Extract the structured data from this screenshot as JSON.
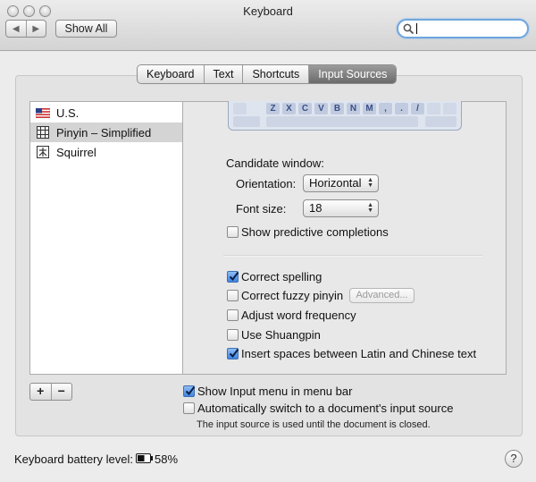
{
  "window": {
    "title": "Keyboard",
    "nav_back": "◀",
    "nav_forward": "▶",
    "show_all_label": "Show All",
    "search_value": ""
  },
  "tabs": [
    {
      "label": "Keyboard",
      "active": false
    },
    {
      "label": "Text",
      "active": false
    },
    {
      "label": "Shortcuts",
      "active": false
    },
    {
      "label": "Input Sources",
      "active": true
    }
  ],
  "input_sources": [
    {
      "label": "U.S.",
      "icon": "us-flag-icon",
      "selected": false
    },
    {
      "label": "Pinyin – Simplified",
      "icon": "pinyin-grid-icon",
      "selected": true
    },
    {
      "label": "Squirrel",
      "icon": "squirrel-icon",
      "selected": false
    }
  ],
  "keyboard_preview": {
    "keys": [
      "",
      "Z",
      "X",
      "C",
      "V",
      "B",
      "N",
      "M",
      ",",
      ".",
      "/",
      "",
      ""
    ]
  },
  "candidate_window": {
    "heading": "Candidate window:",
    "orientation_label": "Orientation:",
    "orientation_value": "Horizontal",
    "font_size_label": "Font size:",
    "font_size_value": "18",
    "show_predictive": {
      "label": "Show predictive completions",
      "checked": false
    }
  },
  "options": {
    "correct_spelling": {
      "label": "Correct spelling",
      "checked": true
    },
    "correct_fuzzy_pinyin": {
      "label": "Correct fuzzy pinyin",
      "checked": false
    },
    "advanced_button": "Advanced...",
    "adjust_word_frequency": {
      "label": "Adjust word frequency",
      "checked": false
    },
    "use_shuangpin": {
      "label": "Use Shuangpin",
      "checked": false
    },
    "insert_spaces": {
      "label": "Insert spaces between Latin and Chinese text",
      "checked": true
    }
  },
  "list_controls": {
    "add_label": "+",
    "remove_label": "−"
  },
  "show_input_menu": {
    "label": "Show Input menu in menu bar",
    "checked": true
  },
  "auto_switch": {
    "label": "Automatically switch to a document's input source",
    "checked": false
  },
  "auto_switch_note": "The input source is used until the document is closed.",
  "battery": {
    "label": "Keyboard battery level:",
    "value": "58%",
    "level_fraction": 0.58
  },
  "help_label": "?",
  "colors": {
    "accent": "#3f84e0",
    "selected_row": "#d4d4d4",
    "tab_active": "#6b6b6b"
  }
}
